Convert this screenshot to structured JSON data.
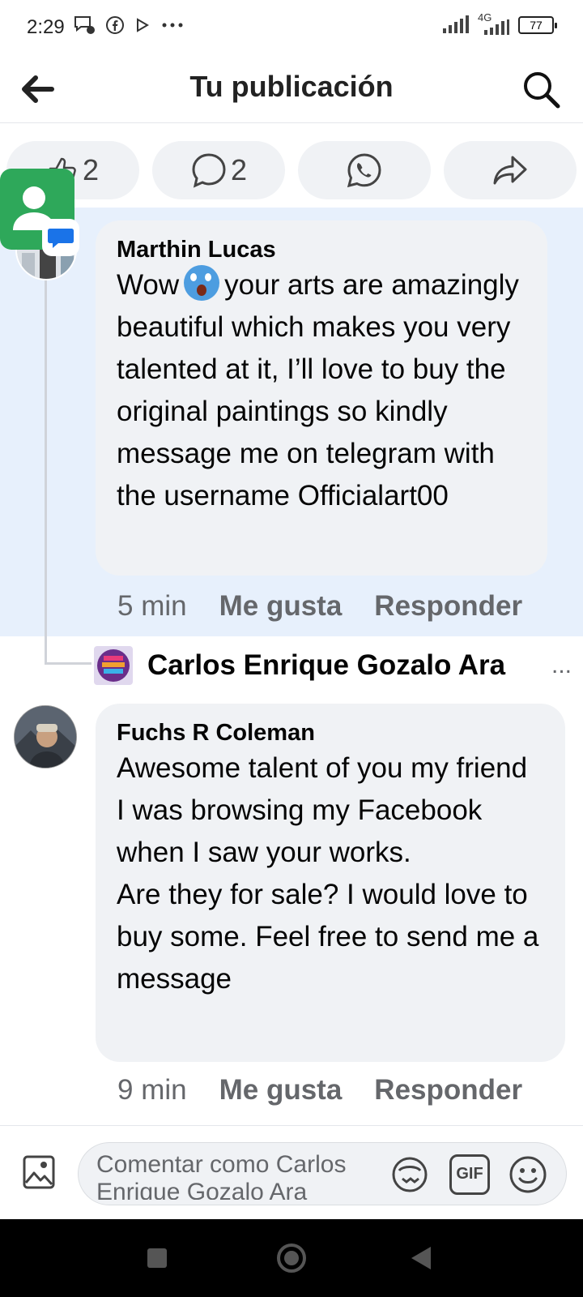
{
  "status_bar": {
    "time": "2:29",
    "network_label": "4G",
    "battery": "77",
    "left_icons": [
      "message-icon",
      "facebook-icon",
      "play-icon",
      "more-dots-icon"
    ]
  },
  "header": {
    "title": "Tu publicación"
  },
  "actions": {
    "like_count": "2",
    "comment_count": "2"
  },
  "comments": [
    {
      "author": "Marthin Lucas",
      "text_before_emoji": "Wow",
      "text_after_emoji": "your arts are amazingly beautiful which makes you very talented at it, I’ll love to buy the original paintings so kindly message me on telegram with the username Officialart00",
      "time": "5 min",
      "like_label": "Me gusta",
      "reply_label": "Responder",
      "highlighted": true
    },
    {
      "author": "Fuchs R Coleman",
      "text": "Awesome talent of you my friend\nI was browsing my Facebook when I saw your works.\nAre they for sale? I would love to buy some. Feel free to send me a message",
      "time": "9 min",
      "like_label": "Me gusta",
      "reply_label": "Responder"
    }
  ],
  "reply_preview": {
    "name": "Carlos Enrique Gozalo Ara",
    "more": "..."
  },
  "composer": {
    "placeholder": "Comentar como Carlos Enrique Gozalo Ara",
    "gif_label": "GIF"
  },
  "colors": {
    "highlight_bg": "#e7f0fc",
    "bubble_bg": "#f0f2f5",
    "secondary_text": "#65676b"
  }
}
